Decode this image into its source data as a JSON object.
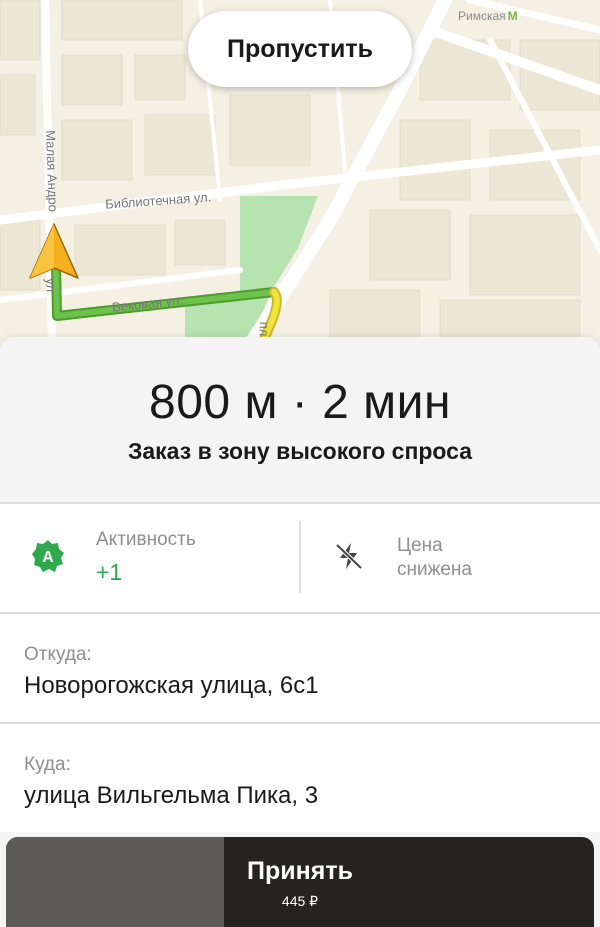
{
  "map": {
    "metro_station": "Римская",
    "metro_icon": "М",
    "streets": {
      "bibliotechnaya": "Библиотечная ул.",
      "vekovaya": "Вековая ул.",
      "malaya_andronyevskaya": "Малая Андро",
      "ul_left": "ул",
      "pl_right": "пл"
    },
    "route_colors": {
      "green": "#6cc24a",
      "yellow": "#f2e33a"
    }
  },
  "skip_button": {
    "label": "Пропустить"
  },
  "order": {
    "eta": "800 м · 2 мин",
    "subtitle": "Заказ в зону высокого спроса"
  },
  "activity": {
    "badge_letter": "A",
    "label": "Активность",
    "value": "+1",
    "color": "#2fa84f"
  },
  "price": {
    "icon": "lightning-crossed-icon",
    "label_line1": "Цена",
    "label_line2": "снижена"
  },
  "from": {
    "label": "Откуда:",
    "address": "Новорогожская улица, 6с1"
  },
  "to": {
    "label": "Куда:",
    "address": "улица Вильгельма Пика, 3"
  },
  "accept_button": {
    "label": "Принять",
    "price": "445 ₽",
    "timer_progress_fraction": 0.37
  }
}
